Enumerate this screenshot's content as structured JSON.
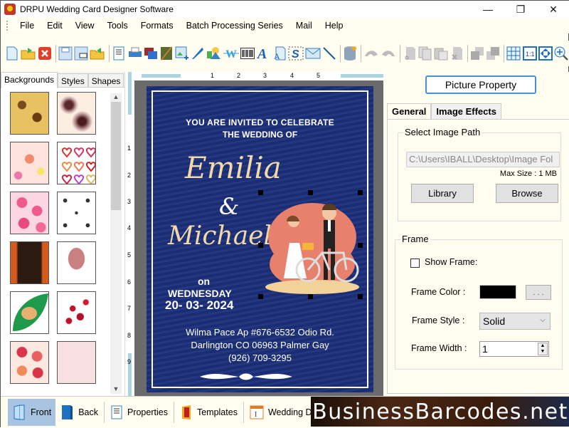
{
  "window": {
    "title": "DRPU Wedding Card Designer Software",
    "controls": [
      "—",
      "❐",
      "✕"
    ]
  },
  "menu": [
    "File",
    "Edit",
    "View",
    "Tools",
    "Formats",
    "Batch Processing Series",
    "Mail",
    "Help"
  ],
  "toolbar": {
    "groups": [
      [
        "new-file",
        "open-file",
        "close-file"
      ],
      [
        "save",
        "save-as",
        "export"
      ],
      [
        "print-preview",
        "print",
        "layers",
        "crop-image",
        "insert-image",
        "pen-tool",
        "shapes-tool",
        "watermark",
        "barcode",
        "text-tool",
        "text-box",
        "signature",
        "email",
        "line-tool"
      ],
      [
        "database"
      ],
      [
        "undo",
        "redo"
      ],
      [
        "cut",
        "copy",
        "paste",
        "delete"
      ],
      [
        "bring-to-front",
        "send-to-back"
      ],
      [
        "grid",
        "actual-size",
        "fit-to-window",
        "zoom-in"
      ]
    ]
  },
  "left_panel": {
    "tabs": [
      "Backgrounds",
      "Styles",
      "Shapes"
    ],
    "active_tab": "Backgrounds",
    "thumbnails": [
      "golden-floral",
      "paisley-lace",
      "pink-flowers",
      "heart-outlines",
      "pink-hearts",
      "couples-pattern",
      "ganesha-orange",
      "elephant-head",
      "ganesha-leaf",
      "rose-petals",
      "hearts-collage",
      "pink-lace"
    ]
  },
  "rulers": {
    "horizontal": [
      "1",
      "2",
      "3",
      "4",
      "5"
    ],
    "vertical": [
      "1",
      "2",
      "3",
      "4",
      "5",
      "6",
      "7",
      "8",
      "9"
    ]
  },
  "card": {
    "invite_line1": "YOU ARE INVITED TO CELEBRATE",
    "invite_line2": "THE WEDDING OF",
    "bride": "Emilia",
    "ampersand": "&",
    "groom": "Michael",
    "on": "on",
    "day": "WEDNESDAY",
    "date": "20- 03- 2024",
    "address1": "Wilma Pace Ap #676-6532 Odio Rd.",
    "address2": "Darlington CO 06963 Palmer Gay",
    "phone": "(926) 709-3295",
    "colors": {
      "background": "#1c2f7a",
      "names": "#f1d9a8",
      "text": "#ffffff"
    }
  },
  "right_panel": {
    "header_button": "Picture Property",
    "tabs": [
      "General",
      "Image Effects"
    ],
    "active_tab": "General",
    "image_path_group": "Select Image Path",
    "image_path_value": "C:\\Users\\IBALL\\Desktop\\Image Fol",
    "max_size": "Max Size : 1 MB",
    "library_button": "Library",
    "browse_button": "Browse",
    "frame_group": "Frame",
    "show_frame_label": "Show Frame:",
    "show_frame_checked": false,
    "frame_color_label": "Frame Color :",
    "frame_color": "#000000",
    "frame_color_button": ". . .",
    "frame_style_label": "Frame Style :",
    "frame_style_value": "Solid",
    "frame_width_label": "Frame Width :",
    "frame_width_value": "1"
  },
  "bottom_bar": {
    "items": [
      "Front",
      "Back",
      "Properties",
      "Templates",
      "Wedding Details"
    ],
    "active": "Front"
  },
  "watermark": "BusinessBarcodes.net"
}
